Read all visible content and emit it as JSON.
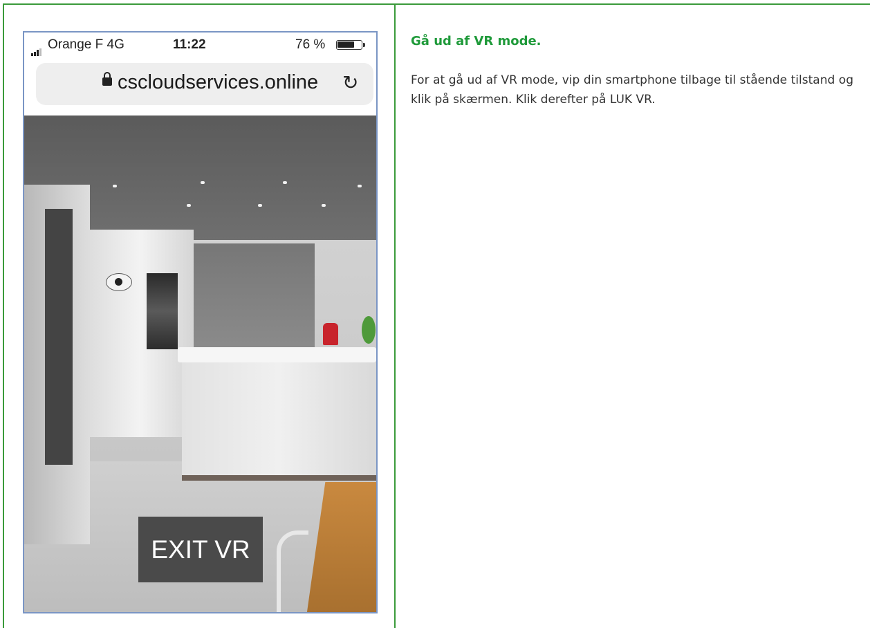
{
  "phone": {
    "status_bar": {
      "carrier": "Orange F  4G",
      "time": "11:22",
      "battery_percent": "76 %",
      "battery_level": 0.76
    },
    "address_bar": {
      "url": "cscloudservices.online",
      "lock_icon": "lock-icon",
      "reload_icon": "reload-icon"
    },
    "vr_scene": {
      "exit_button_label": "EXIT VR",
      "hotspot_icon": "eye-icon"
    }
  },
  "instructions": {
    "heading": "Gå ud af VR mode.",
    "body": "For at gå ud af VR mode, vip din smartphone tilbage til stående tilstand og klik på skærmen. Klik derefter på LUK VR."
  },
  "colors": {
    "accent_green": "#1f9a3a",
    "border_green": "#3a9a3a",
    "phone_border": "#7a95c4",
    "exit_button_bg": "#4a4a4a"
  }
}
